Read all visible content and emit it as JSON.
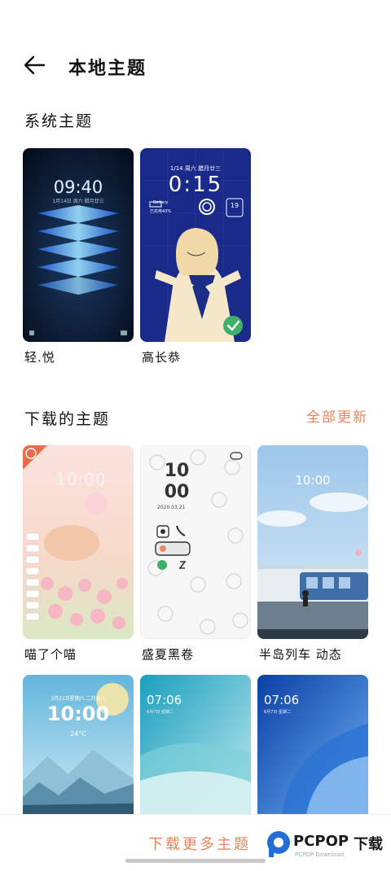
{
  "header": {
    "title": "本地主题"
  },
  "system_section": {
    "title": "系统主题",
    "items": [
      {
        "name": "轻.悦",
        "clock": "09:40",
        "date": "1月14日 周六 腊月廿三"
      },
      {
        "name": "高长恭",
        "clock": "0:15",
        "date": "1/14 周六 腊月廿三",
        "battery_label": "Battery",
        "battery_value": "已充电43%",
        "badge_num": "19"
      }
    ]
  },
  "download_section": {
    "title": "下载的主题",
    "update_all": "全部更新",
    "items": [
      {
        "name": "喵了个喵",
        "clock": "10:00"
      },
      {
        "name": "盛夏黑卷",
        "clock_h": "10",
        "clock_m": "00",
        "date": "2020.03.21"
      },
      {
        "name": "半岛列车 动态",
        "clock": "10:00"
      },
      {
        "name": "",
        "clock": "10:00",
        "date": "3月21日星期六 二月廿八",
        "temp": "24°C"
      },
      {
        "name": "",
        "clock": "07:06",
        "date": "6月7日 星期二"
      },
      {
        "name": "",
        "clock": "07:06",
        "date": "6月7日 星期二"
      }
    ]
  },
  "bottom": {
    "download_more": "下载更多主题",
    "watermark": "PCPOP",
    "watermark_suffix": "下载",
    "watermark_sub": "PCPOP Download"
  },
  "colors": {
    "accent": "#e8855a"
  }
}
